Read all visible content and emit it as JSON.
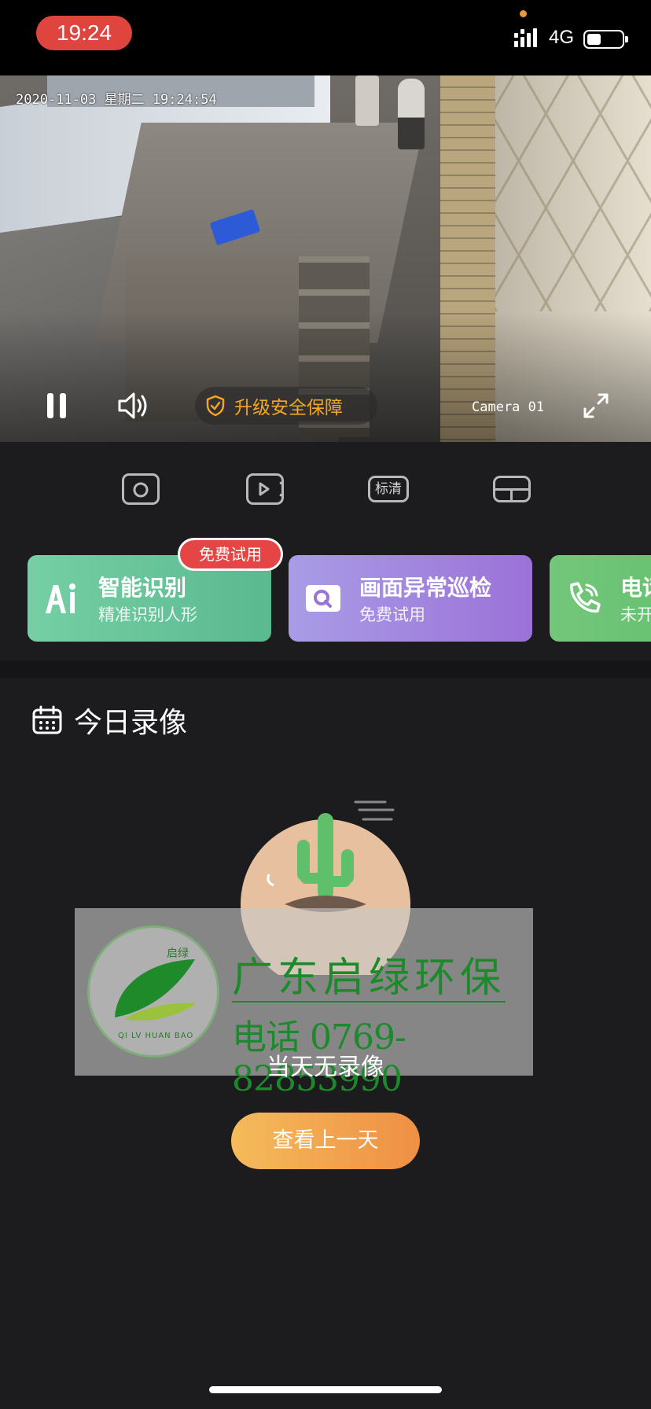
{
  "status_bar": {
    "time": "19:24",
    "network": "4G"
  },
  "video": {
    "timestamp": "2020-11-03 星期二 19:24:54",
    "camera_label": "Camera 01",
    "upgrade_label": "升级安全保障"
  },
  "toolbar": {
    "quality_label": "标清"
  },
  "feature_cards": {
    "badge": "免费试用",
    "items": [
      {
        "title": "智能识别",
        "subtitle": "精准识别人形"
      },
      {
        "title": "画面异常巡检",
        "subtitle": "免费试用"
      },
      {
        "title": "电话",
        "subtitle": "未开"
      }
    ]
  },
  "recordings": {
    "title": "今日录像",
    "empty_text": "当天无录像",
    "prev_day_button": "查看上一天"
  },
  "watermark": {
    "company": "广东启绿环保",
    "phone": "电话 0769-82853990",
    "logo_tag": "启绿",
    "logo_en": "QI LV HUAN BAO"
  },
  "colors": {
    "accent_orange": "#f5a623",
    "time_pill": "#e0443e",
    "card_green": "#5bb98f",
    "card_purple": "#9b72d8",
    "badge_red": "#e54545"
  }
}
